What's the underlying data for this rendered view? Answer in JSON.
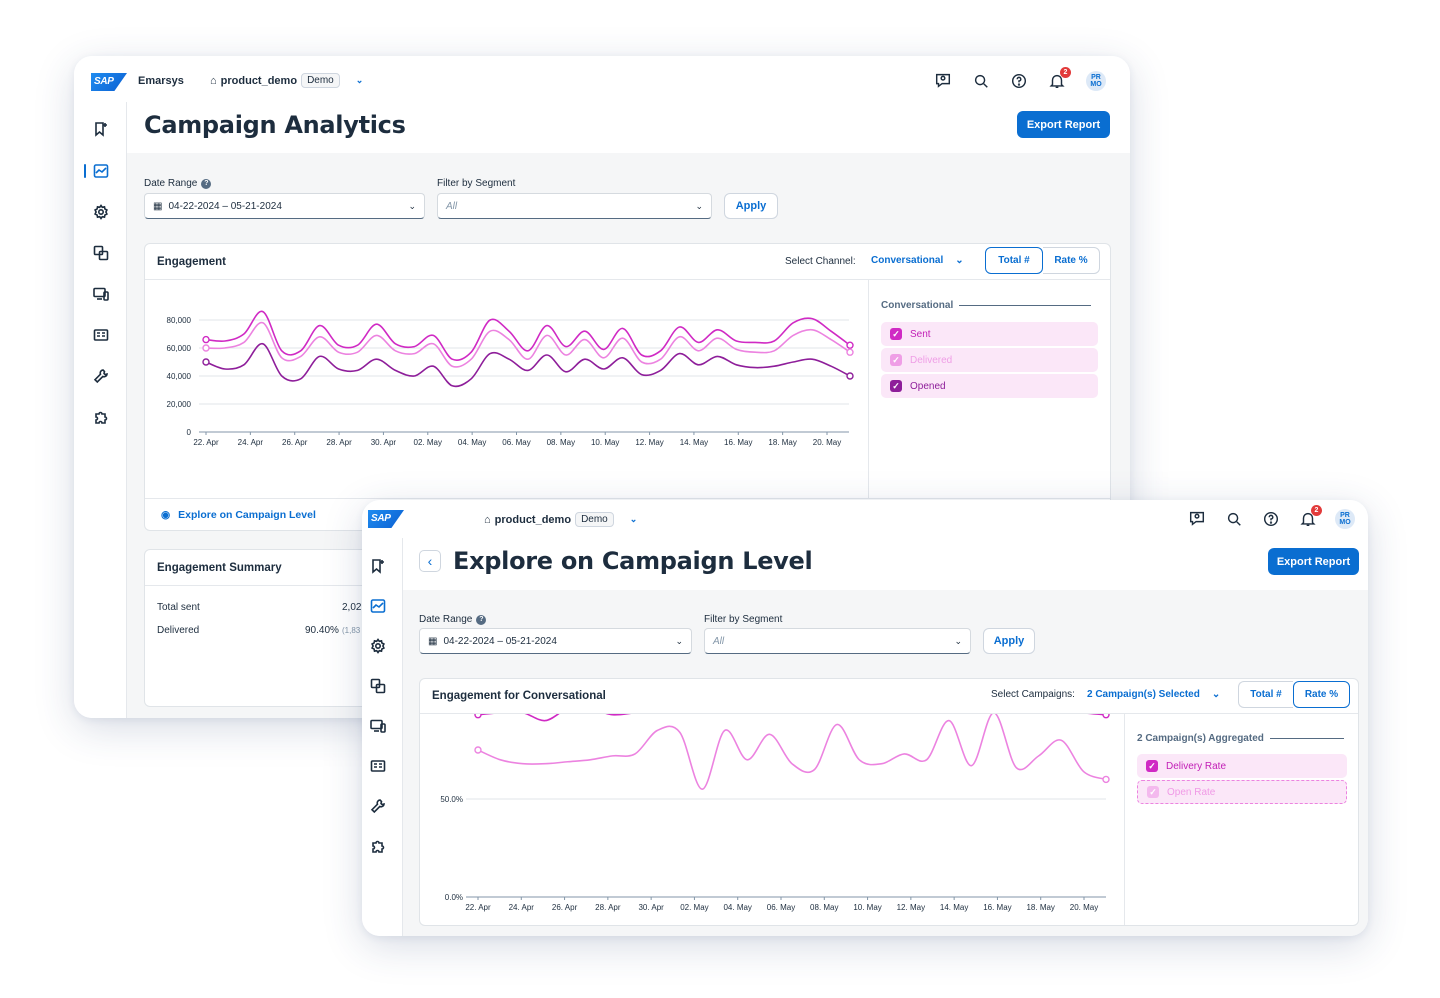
{
  "colors": {
    "accent": "#0a6ed1",
    "sent": "#d02ac4",
    "delivered": "#ec83e0",
    "opened": "#8e1e9a"
  },
  "window1": {
    "brand": "SAP",
    "app_name": "Emarsys",
    "tenant": "product_demo",
    "tenant_badge": "Demo",
    "notif_count": "2",
    "avatar": "PR MO",
    "title": "Campaign Analytics",
    "export_label": "Export Report",
    "date_range_label": "Date Range",
    "date_range_value": "04-22-2024 – 05-21-2024",
    "segment_label": "Filter by Segment",
    "segment_value": "All",
    "apply_label": "Apply",
    "engagement_title": "Engagement",
    "channel_label": "Select Channel:",
    "channel_value": "Conversational",
    "total_label": "Total #",
    "rate_label": "Rate %",
    "legend_title": "Conversational",
    "legend": [
      {
        "label": "Sent",
        "checked": true
      },
      {
        "label": "Delivered",
        "checked": true
      },
      {
        "label": "Opened",
        "checked": true
      }
    ],
    "explore_link": "Explore on Campaign Level",
    "summary_title": "Engagement Summary",
    "summary_rows": [
      {
        "label": "Total sent",
        "value": "2,02"
      },
      {
        "label": "Delivered",
        "value": "90.40%",
        "sub": "(1,83"
      }
    ],
    "sidebar_icons": [
      "bookmark-icon",
      "analytics-icon",
      "automation-gear-icon",
      "content-icon",
      "devices-icon",
      "contacts-card-icon",
      "tools-icon",
      "addons-puzzle-icon"
    ]
  },
  "chart_data": [
    {
      "type": "line",
      "title": "Engagement",
      "ylim": [
        0,
        80000
      ],
      "yticks": [
        "80,000",
        "60,000",
        "40,000",
        "20,000",
        "0"
      ],
      "x": [
        "22. Apr",
        "24. Apr",
        "26. Apr",
        "28. Apr",
        "30. Apr",
        "02. May",
        "04. May",
        "06. May",
        "08. May",
        "10. May",
        "12. May",
        "14. May",
        "16. May",
        "18. May",
        "20. May"
      ],
      "series": [
        {
          "name": "Sent",
          "values": [
            66000,
            65000,
            70000,
            86000,
            58000,
            58000,
            76000,
            62000,
            62000,
            77000,
            63000,
            61000,
            69000,
            52000,
            57000,
            80000,
            72000,
            58000,
            76000,
            61000,
            72000,
            59000,
            74000,
            55000,
            58000,
            75000,
            64000,
            73000,
            65000,
            64000,
            65000,
            78000,
            81000,
            72000,
            62000
          ]
        },
        {
          "name": "Delivered",
          "values": [
            60000,
            60000,
            64000,
            78000,
            53000,
            54000,
            68000,
            57000,
            57000,
            69000,
            58000,
            56000,
            63000,
            47000,
            52000,
            72000,
            66000,
            52000,
            69000,
            55000,
            66000,
            53000,
            67000,
            50000,
            52000,
            68000,
            58000,
            67000,
            59000,
            57000,
            58000,
            69000,
            73000,
            66000,
            57000
          ]
        },
        {
          "name": "Opened",
          "values": [
            50000,
            45000,
            48000,
            63000,
            40000,
            38000,
            54000,
            45000,
            44000,
            52000,
            44000,
            40000,
            47000,
            33000,
            38000,
            56000,
            52000,
            44000,
            55000,
            43000,
            52000,
            45000,
            53000,
            41000,
            44000,
            56000,
            48000,
            54000,
            48000,
            46000,
            47000,
            50000,
            52000,
            47000,
            40000
          ]
        }
      ]
    },
    {
      "type": "line",
      "title": "Engagement for Conversational",
      "ylim": [
        0,
        100
      ],
      "yticks": [
        "50.0%",
        "0.0%"
      ],
      "x": [
        "22. Apr",
        "24. Apr",
        "26. Apr",
        "28. Apr",
        "30. Apr",
        "02. May",
        "04. May",
        "06. May",
        "08. May",
        "10. May",
        "12. May",
        "14. May",
        "16. May",
        "18. May",
        "20. May"
      ],
      "series": [
        {
          "name": "Delivery Rate",
          "values": [
            93,
            94,
            94,
            90,
            96,
            96,
            93,
            94,
            95,
            95,
            96,
            95,
            96,
            95,
            94,
            96,
            94,
            97,
            98,
            94,
            96,
            97,
            98,
            95,
            96,
            99,
            96,
            94,
            93
          ]
        },
        {
          "name": "Open Rate",
          "values": [
            75,
            70,
            68,
            68,
            69,
            70,
            72,
            73,
            85,
            84,
            55,
            85,
            70,
            83,
            68,
            65,
            88,
            70,
            68,
            73,
            70,
            90,
            67,
            94,
            66,
            72,
            80,
            64,
            60
          ]
        }
      ]
    }
  ],
  "window2": {
    "brand": "SAP",
    "tenant": "product_demo",
    "tenant_badge": "Demo",
    "notif_count": "2",
    "avatar": "PR MO",
    "back": "‹",
    "title": "Explore on Campaign Level",
    "export_label": "Export Report",
    "date_range_label": "Date Range",
    "date_range_value": "04-22-2024 – 05-21-2024",
    "segment_label": "Filter by Segment",
    "segment_value": "All",
    "apply_label": "Apply",
    "engagement_title": "Engagement for Conversational",
    "campaigns_label": "Select Campaigns:",
    "campaigns_value": "2 Campaign(s) Selected",
    "total_label": "Total #",
    "rate_label": "Rate %",
    "legend_title": "2 Campaign(s) Aggregated",
    "legend": [
      {
        "label": "Delivery Rate",
        "checked": true
      },
      {
        "label": "Open Rate",
        "checked": true
      }
    ]
  }
}
